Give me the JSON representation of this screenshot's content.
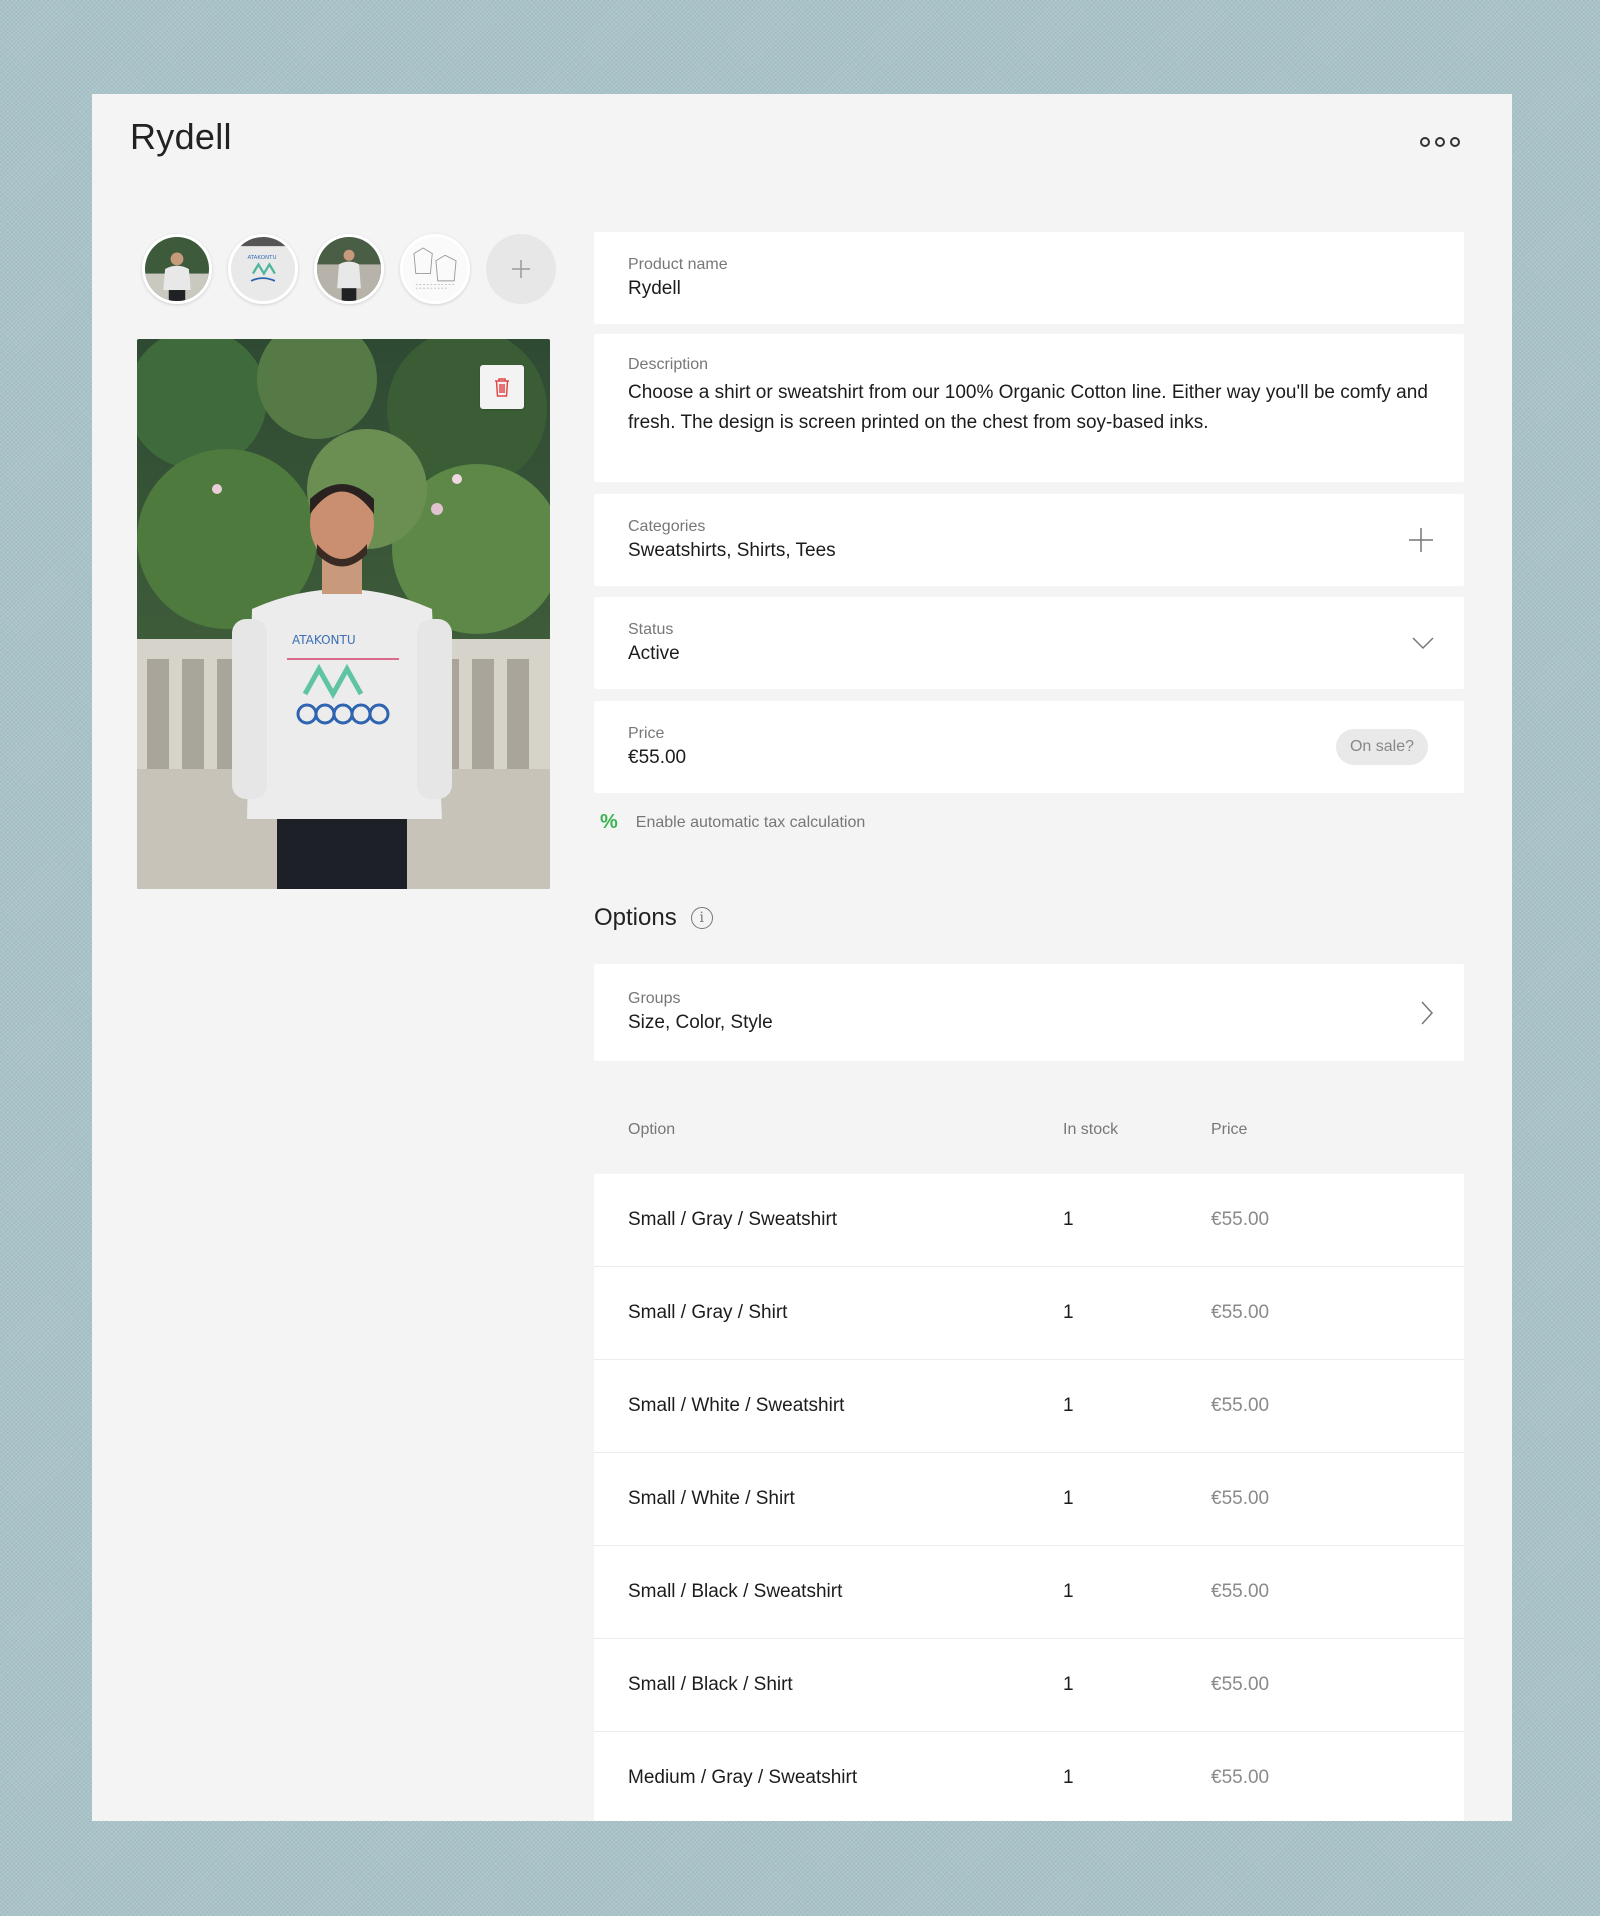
{
  "header": {
    "title": "Rydell",
    "more_icon": "more-horizontal-icon"
  },
  "thumbnails": [
    {
      "name": "thumb-photo-1"
    },
    {
      "name": "thumb-photo-2"
    },
    {
      "name": "thumb-photo-3"
    },
    {
      "name": "thumb-sketch-4"
    }
  ],
  "fields": {
    "product_name": {
      "label": "Product name",
      "value": "Rydell"
    },
    "description": {
      "label": "Description",
      "value": "Choose a shirt or sweatshirt from our 100% Organic Cotton line. Either way you'll be comfy and fresh. The design is screen printed on the chest from soy-based inks."
    },
    "categories": {
      "label": "Categories",
      "value": "Sweatshirts, Shirts, Tees"
    },
    "status": {
      "label": "Status",
      "value": "Active"
    },
    "price": {
      "label": "Price",
      "value": "€55.00",
      "sale_label": "On sale?"
    }
  },
  "tax": {
    "icon": "%",
    "label": "Enable automatic tax calculation"
  },
  "options": {
    "heading": "Options",
    "info_icon": "i",
    "groups": {
      "label": "Groups",
      "value": "Size, Color, Style"
    },
    "columns": {
      "option": "Option",
      "in_stock": "In stock",
      "price": "Price"
    },
    "rows": [
      {
        "option": "Small / Gray / Sweatshirt",
        "stock": "1",
        "price": "€55.00"
      },
      {
        "option": "Small / Gray / Shirt",
        "stock": "1",
        "price": "€55.00"
      },
      {
        "option": "Small / White / Sweatshirt",
        "stock": "1",
        "price": "€55.00"
      },
      {
        "option": "Small / White / Shirt",
        "stock": "1",
        "price": "€55.00"
      },
      {
        "option": "Small / Black / Sweatshirt",
        "stock": "1",
        "price": "€55.00"
      },
      {
        "option": "Small / Black / Shirt",
        "stock": "1",
        "price": "€55.00"
      },
      {
        "option": "Medium / Gray / Sweatshirt",
        "stock": "1",
        "price": "€55.00"
      }
    ]
  },
  "colors": {
    "accent_green": "#3bb552",
    "delete_red": "#e04848",
    "background": "#a9c3c9",
    "panel": "#f4f4f4"
  }
}
